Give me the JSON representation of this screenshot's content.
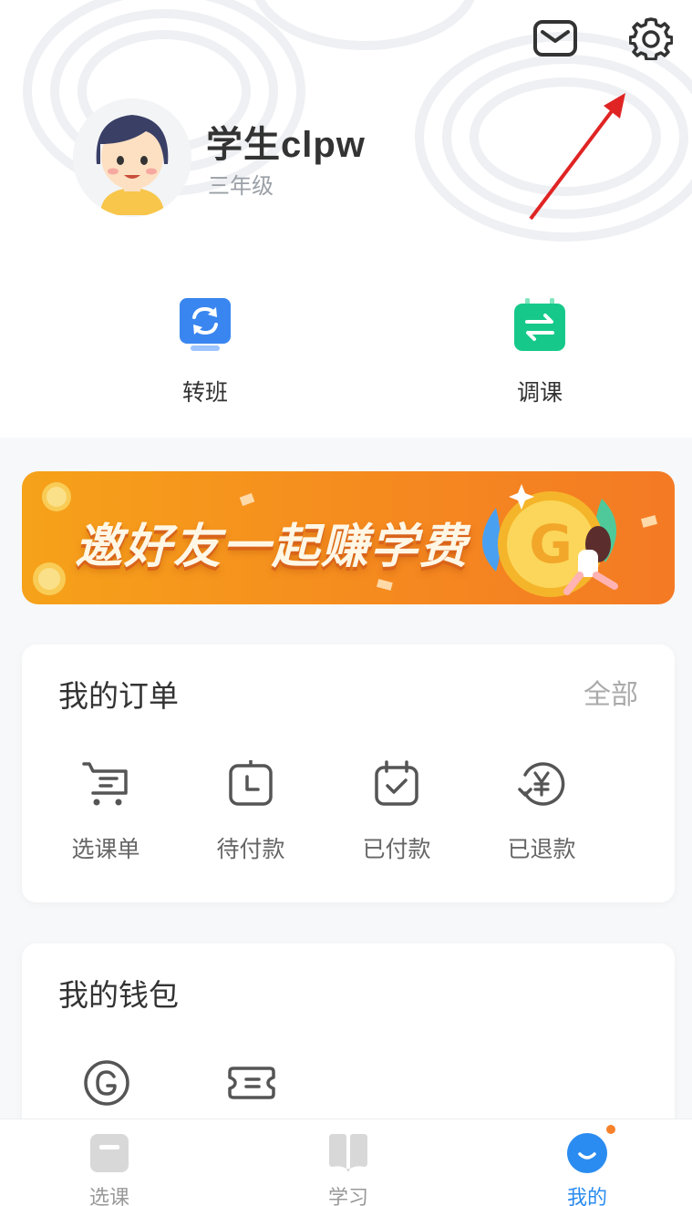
{
  "header": {
    "icons": [
      "mail-icon",
      "gear-icon"
    ],
    "user": {
      "name": "学生clpw",
      "grade": "三年级"
    }
  },
  "quick_actions": [
    {
      "label": "转班",
      "icon": "swap-class-icon",
      "color": "#3a86f0"
    },
    {
      "label": "调课",
      "icon": "reschedule-icon",
      "color": "#16c98a"
    }
  ],
  "banner": {
    "text": "邀好友一起赚学费",
    "colors": [
      "#f6a21a",
      "#f47a24"
    ]
  },
  "orders": {
    "title": "我的订单",
    "more": "全部",
    "items": [
      {
        "label": "选课单",
        "icon": "cart-icon"
      },
      {
        "label": "待付款",
        "icon": "clock-icon"
      },
      {
        "label": "已付款",
        "icon": "calendar-check-icon"
      },
      {
        "label": "已退款",
        "icon": "refund-yen-icon"
      }
    ]
  },
  "wallet": {
    "title": "我的钱包",
    "items": [
      {
        "icon": "g-coin-icon"
      },
      {
        "icon": "coupon-icon"
      }
    ]
  },
  "bottom_nav": {
    "items": [
      {
        "label": "选课",
        "icon": "select-course-icon"
      },
      {
        "label": "学习",
        "icon": "study-book-icon"
      },
      {
        "label": "我的",
        "icon": "smile-profile-icon",
        "active": true
      }
    ],
    "accent": "#2a8cf0",
    "badge_color": "#f5822b"
  }
}
